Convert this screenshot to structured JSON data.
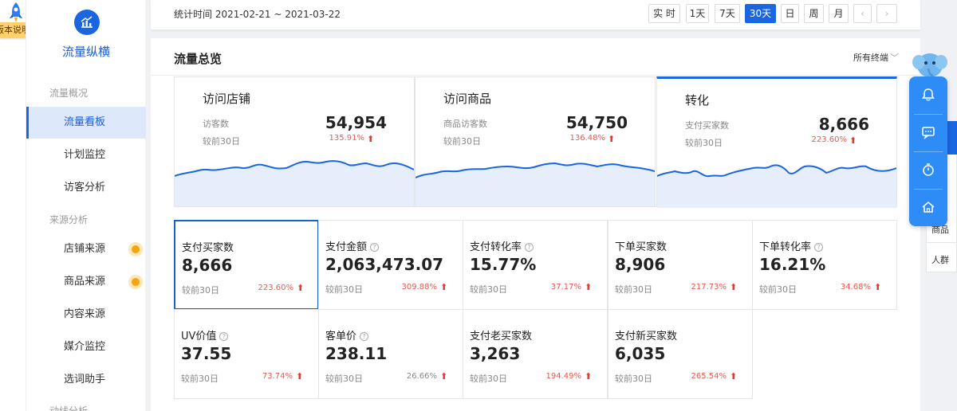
{
  "badge": {
    "text": "版本说明"
  },
  "sidebar": {
    "logo_title": "流量纵横",
    "sections": [
      "流量概况",
      "来源分析",
      "动线分析"
    ],
    "items": [
      {
        "label": "流量看板",
        "active": true
      },
      {
        "label": "计划监控"
      },
      {
        "label": "访客分析"
      },
      {
        "label": "店铺来源",
        "dot": true
      },
      {
        "label": "商品来源",
        "dot": true
      },
      {
        "label": "内容来源"
      },
      {
        "label": "媒介监控"
      },
      {
        "label": "选词助手"
      }
    ]
  },
  "datebar": {
    "range": "统计时间 2021-02-21 ~ 2021-03-22",
    "periods": [
      "实 时",
      "1天",
      "7天",
      "30天",
      "日",
      "周",
      "月"
    ],
    "active_period": "30天",
    "prev": "‹",
    "next": "›"
  },
  "panel": {
    "title": "流量总览",
    "terminal": "所有终端",
    "terminal_chevron": "﹀"
  },
  "overview": [
    {
      "title": "访问店铺",
      "label": "访客数",
      "value": "54,954",
      "compare": "较前30日",
      "pct": "135.91%",
      "active": false
    },
    {
      "title": "访问商品",
      "label": "商品访客数",
      "value": "54,750",
      "compare": "较前30日",
      "pct": "136.48%",
      "active": false
    },
    {
      "title": "转化",
      "label": "支付买家数",
      "value": "8,666",
      "compare": "较前30日",
      "pct": "223.60%",
      "active": true
    }
  ],
  "metrics": [
    {
      "title": "支付买家数",
      "help": false,
      "value": "8,666",
      "compare": "较前30日",
      "pct": "223.60%",
      "up": true,
      "selected": true
    },
    {
      "title": "支付金额",
      "help": true,
      "value": "2,063,473.07",
      "compare": "较前30日",
      "pct": "309.88%",
      "up": true
    },
    {
      "title": "支付转化率",
      "help": true,
      "value": "15.77%",
      "compare": "较前30日",
      "pct": "37.17%",
      "up": true
    },
    {
      "title": "下单买家数",
      "help": false,
      "value": "8,906",
      "compare": "较前30日",
      "pct": "217.73%",
      "up": true
    },
    {
      "title": "下单转化率",
      "help": true,
      "value": "16.21%",
      "compare": "较前30日",
      "pct": "34.68%",
      "up": true
    },
    {
      "title": "UV价值",
      "help": true,
      "value": "37.55",
      "compare": "较前30日",
      "pct": "73.74%",
      "up": true
    },
    {
      "title": "客单价",
      "help": true,
      "value": "238.11",
      "compare": "较前30日",
      "pct": "26.66%",
      "up": true,
      "grey": true
    },
    {
      "title": "支付老买家数",
      "help": false,
      "value": "3,263",
      "compare": "较前30日",
      "pct": "194.49%",
      "up": true
    },
    {
      "title": "支付新买家数",
      "help": false,
      "value": "6,035",
      "compare": "较前30日",
      "pct": "265.54%",
      "up": true
    }
  ],
  "float_bar": [
    "bell-icon",
    "message-icon",
    "timer-icon",
    "home-icon"
  ],
  "right_tabs": [
    "商品",
    "人群"
  ],
  "colors": {
    "accent": "#1a66e0",
    "up": "#e23a2e",
    "float": "#2d8cf6"
  }
}
